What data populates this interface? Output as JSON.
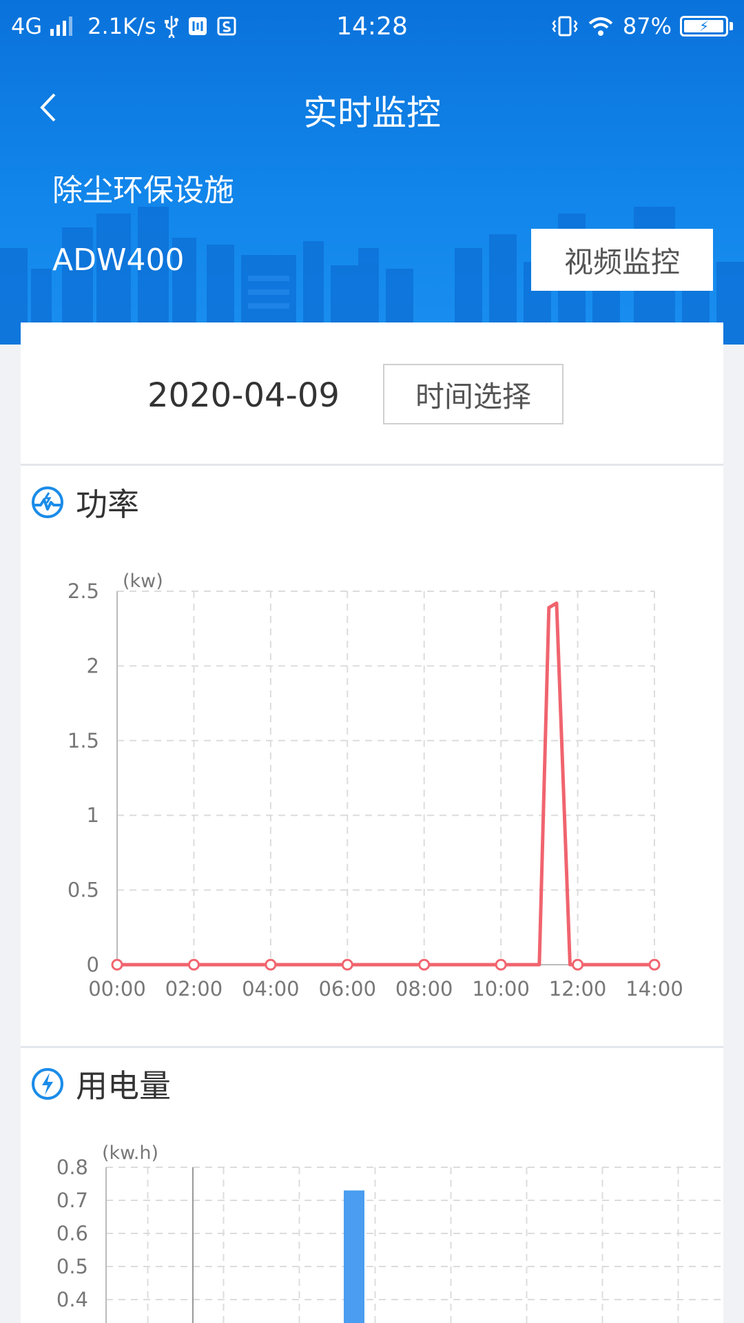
{
  "status_bar": {
    "network": "4G",
    "speed": "2.1K/s",
    "time": "14:28",
    "battery": "87%",
    "icons": [
      "signal-icon",
      "usb-icon",
      "usb-debug-icon",
      "storage-icon",
      "vibrate-icon",
      "wifi-icon",
      "battery-icon"
    ]
  },
  "nav": {
    "title": "实时监控",
    "back_icon": "chevron-left-icon"
  },
  "facility": {
    "name": "除尘环保设施",
    "model": "ADW400",
    "video_button": "视频监控"
  },
  "date_selector": {
    "date": "2020-04-09",
    "button": "时间选择"
  },
  "power_section": {
    "title": "功率",
    "icon": "power-chart-icon"
  },
  "energy_section": {
    "title": "用电量",
    "icon": "lightning-icon"
  },
  "colors": {
    "header_blue": "#0f7be3",
    "line_red": "#f0646e",
    "bar_blue": "#4a9df0",
    "grid": "#dcdcdc",
    "axis_text": "#777777"
  },
  "chart_data": [
    {
      "type": "line",
      "title": "",
      "unit": "(kw)",
      "xlabel": "",
      "ylabel": "",
      "x_ticks": [
        "00:00",
        "02:00",
        "04:00",
        "06:00",
        "08:00",
        "10:00",
        "12:00",
        "14:00"
      ],
      "y_ticks": [
        "0",
        "0.5",
        "1",
        "1.5",
        "2",
        "2.5"
      ],
      "xlim": [
        0,
        14
      ],
      "ylim": [
        0,
        2.5
      ],
      "grid": true,
      "series": [
        {
          "color": "#f0646e",
          "points": [
            [
              0,
              0
            ],
            [
              2,
              0
            ],
            [
              4,
              0
            ],
            [
              6,
              0
            ],
            [
              8,
              0
            ],
            [
              10,
              0
            ],
            [
              11,
              0
            ],
            [
              11.25,
              2.39
            ],
            [
              11.45,
              2.42
            ],
            [
              11.8,
              0
            ],
            [
              12,
              0
            ],
            [
              14,
              0
            ]
          ],
          "markers": [
            0,
            2,
            4,
            6,
            8,
            10,
            12,
            14
          ]
        }
      ]
    },
    {
      "type": "bar",
      "title": "",
      "unit": "(kw.h)",
      "y_ticks": [
        "0.4",
        "0.5",
        "0.6",
        "0.7",
        "0.8"
      ],
      "ylim": [
        0.4,
        0.8
      ],
      "grid": true,
      "series": [
        {
          "color": "#4a9df0",
          "bars": [
            {
              "slot": 3.5,
              "value": 0.73
            }
          ]
        }
      ]
    }
  ]
}
